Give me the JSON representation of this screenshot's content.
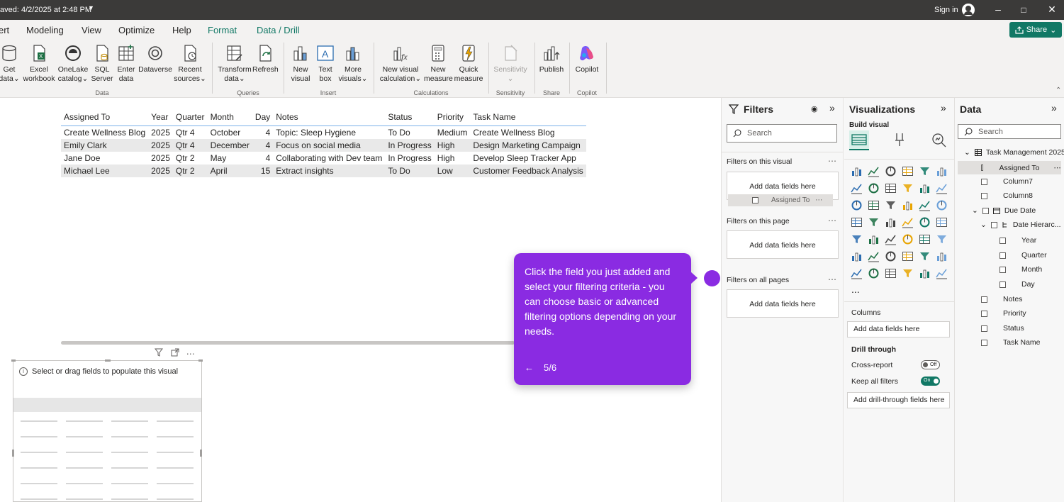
{
  "titlebar": {
    "saved_text": "aved: 4/2/2025 at 2:48 PM",
    "signin": "Sign in"
  },
  "menu": {
    "tabs": [
      "ert",
      "Modeling",
      "View",
      "Optimize",
      "Help",
      "Format",
      "Data / Drill"
    ],
    "share": "Share"
  },
  "ribbon": {
    "buttons": [
      {
        "l1": "Get",
        "l2": "data"
      },
      {
        "l1": "Excel",
        "l2": "workbook"
      },
      {
        "l1": "OneLake",
        "l2": "catalog"
      },
      {
        "l1": "SQL",
        "l2": "Server"
      },
      {
        "l1": "Enter",
        "l2": "data"
      },
      {
        "l1": "Dataverse",
        "l2": ""
      },
      {
        "l1": "Recent",
        "l2": "sources"
      },
      {
        "l1": "Transform",
        "l2": "data"
      },
      {
        "l1": "Refresh",
        "l2": ""
      },
      {
        "l1": "New",
        "l2": "visual"
      },
      {
        "l1": "Text",
        "l2": "box"
      },
      {
        "l1": "More",
        "l2": "visuals"
      },
      {
        "l1": "New visual",
        "l2": "calculation"
      },
      {
        "l1": "New",
        "l2": "measure"
      },
      {
        "l1": "Quick",
        "l2": "measure"
      },
      {
        "l1": "Sensitivity",
        "l2": ""
      },
      {
        "l1": "Publish",
        "l2": ""
      },
      {
        "l1": "Copilot",
        "l2": ""
      }
    ],
    "groups": [
      "Data",
      "Queries",
      "Insert",
      "Calculations",
      "Sensitivity",
      "Share",
      "Copilot"
    ]
  },
  "table": {
    "headers": [
      "Assigned To",
      "Year",
      "Quarter",
      "Month",
      "Day",
      "Notes",
      "Status",
      "Priority",
      "Task Name"
    ],
    "rows": [
      [
        "Create Wellness Blog",
        "2025",
        "Qtr 4",
        "October",
        "4",
        "Topic: Sleep Hygiene",
        "To Do",
        "Medium",
        "Create Wellness Blog"
      ],
      [
        "Emily Clark",
        "2025",
        "Qtr 4",
        "December",
        "4",
        "Focus on social media",
        "In Progress",
        "High",
        "Design Marketing Campaign"
      ],
      [
        "Jane Doe",
        "2025",
        "Qtr 2",
        "May",
        "4",
        "Collaborating with Dev team",
        "In Progress",
        "High",
        "Develop Sleep Tracker App"
      ],
      [
        "Michael Lee",
        "2025",
        "Qtr 2",
        "April",
        "15",
        "Extract insights",
        "To Do",
        "Low",
        "Customer Feedback Analysis"
      ]
    ]
  },
  "empty_visual": {
    "message": "Select or drag fields to populate this visual"
  },
  "tooltip": {
    "text": "Click the field you just added and select your filtering criteria - you can choose basic or advanced filtering options depending on your needs.",
    "step": "5/6"
  },
  "filters": {
    "title": "Filters",
    "search_placeholder": "Search",
    "on_visual": "Filters on this visual",
    "on_page": "Filters on this page",
    "on_all": "Filters on all pages",
    "drop_text": "Add data fields here",
    "chip_field": "Assigned To"
  },
  "visualizations": {
    "title": "Visualizations",
    "build_visual": "Build visual",
    "more": "...",
    "columns": "Columns",
    "columns_drop": "Add data fields here",
    "drill_through": "Drill through",
    "cross_report": "Cross-report",
    "cross_report_state": "Off",
    "keep_all_filters": "Keep all filters",
    "keep_all_filters_state": "On",
    "drill_drop": "Add drill-through fields here"
  },
  "data": {
    "title": "Data",
    "search_placeholder": "Search",
    "table_name": "Task Management 2025",
    "fields": {
      "assigned_to": "Assigned To",
      "column7": "Column7",
      "column8": "Column8",
      "due_date": "Due Date",
      "date_hierarchy": "Date Hierarc...",
      "year": "Year",
      "quarter": "Quarter",
      "month": "Month",
      "day": "Day",
      "notes": "Notes",
      "priority": "Priority",
      "status": "Status",
      "task_name": "Task Name"
    }
  },
  "colors": {
    "accent": "#117865",
    "tooltip": "#8a2be2",
    "titlebar": "#3b3a39"
  }
}
